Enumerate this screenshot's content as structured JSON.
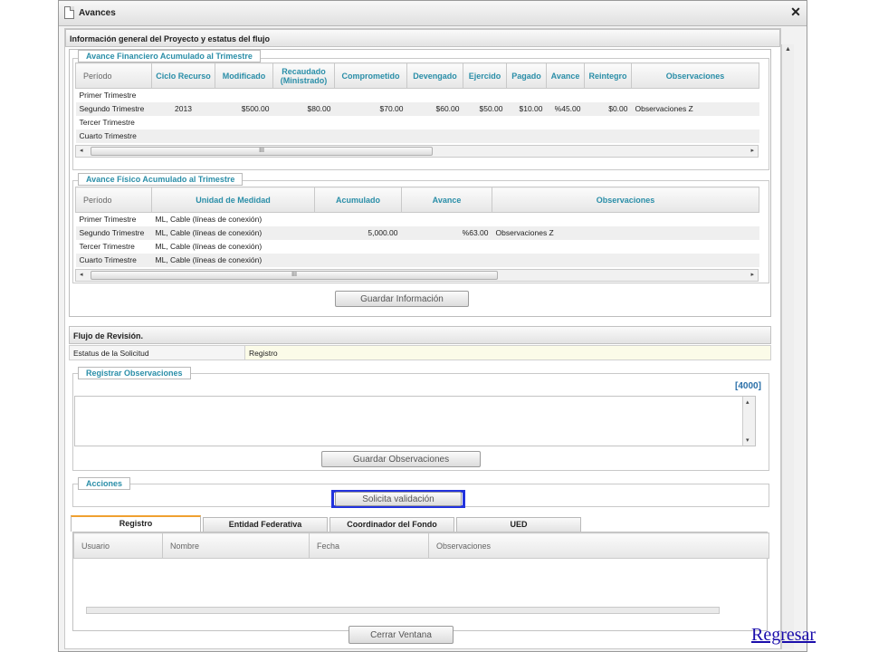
{
  "window": {
    "title": "Avances",
    "close_glyph": "✕"
  },
  "project_section": {
    "header": "Información general del Proyecto y estatus del flujo"
  },
  "financial": {
    "legend": "Avance Financiero Acumulado al Trimestre",
    "columns": [
      "Período",
      "Ciclo Recurso",
      "Modificado",
      "Recaudado (Ministrado)",
      "Comprometido",
      "Devengado",
      "Ejercido",
      "Pagado",
      "Avance",
      "Reintegro",
      "Observaciones"
    ],
    "rows": [
      [
        "Primer Trimestre",
        "",
        "",
        "",
        "",
        "",
        "",
        "",
        "",
        "",
        ""
      ],
      [
        "Segundo Trimestre",
        "2013",
        "$500.00",
        "$80.00",
        "$70.00",
        "$60.00",
        "$50.00",
        "$10.00",
        "%45.00",
        "$0.00",
        "Observaciones Z"
      ],
      [
        "Tercer Trimestre",
        "",
        "",
        "",
        "",
        "",
        "",
        "",
        "",
        "",
        ""
      ],
      [
        "Cuarto Trimestre",
        "",
        "",
        "",
        "",
        "",
        "",
        "",
        "",
        "",
        ""
      ]
    ],
    "scroll_grip": "III"
  },
  "physical": {
    "legend": "Avance Físico Acumulado al Trimestre",
    "columns": [
      "Período",
      "Unidad de Medidad",
      "Acumulado",
      "Avance",
      "Observaciones"
    ],
    "rows": [
      [
        "Primer Trimestre",
        "ML, Cable (líneas de conexión)",
        "",
        "",
        ""
      ],
      [
        "Segundo Trimestre",
        "ML, Cable (líneas de conexión)",
        "5,000.00",
        "%63.00",
        "Observaciones Z"
      ],
      [
        "Tercer Trimestre",
        "ML, Cable (líneas de conexión)",
        "",
        "",
        ""
      ],
      [
        "Cuarto Trimestre",
        "ML, Cable (líneas de conexión)",
        "",
        "",
        ""
      ]
    ],
    "scroll_grip": "III"
  },
  "save_info_button": "Guardar Información",
  "review": {
    "header": "Flujo de Revisión.",
    "status_label": "Estatus de la Solicitud",
    "status_value": "Registro"
  },
  "observations": {
    "legend": "Registrar Observaciones",
    "counter": "[4000]",
    "value": "",
    "save_button": "Guardar Observaciones"
  },
  "actions": {
    "legend": "Acciones",
    "request_button": "Solicita validación",
    "highlight_color": "#2233dd"
  },
  "tabs": [
    {
      "label": "Registro",
      "active": true
    },
    {
      "label": "Entidad Federativa",
      "active": false
    },
    {
      "label": "Coordinador del Fondo",
      "active": false
    },
    {
      "label": "UED",
      "active": false
    }
  ],
  "history": {
    "columns": [
      "Usuario",
      "Nombre",
      "Fecha",
      "Observaciones"
    ]
  },
  "close_window_button": "Cerrar Ventana",
  "back_link": "Regresar",
  "colors": {
    "accent_teal": "#2a8ea8",
    "active_tab": "#f0a030"
  }
}
